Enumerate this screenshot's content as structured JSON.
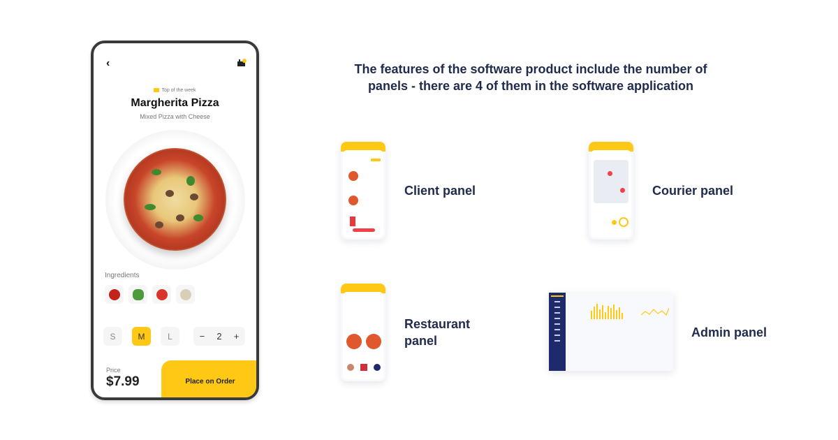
{
  "phone": {
    "back_icon": "chevron-left",
    "cart_icon": "basket",
    "badge": "Top of the week",
    "product_title": "Margherita Pizza",
    "product_subtitle": "Mixed Pizza with Cheese",
    "ingredients_label": "Ingredients",
    "ingredients": [
      "tomato-sauce",
      "vegetables",
      "tomatoes",
      "dough"
    ],
    "sizes": [
      {
        "label": "S",
        "selected": false
      },
      {
        "label": "M",
        "selected": true
      },
      {
        "label": "L",
        "selected": false
      }
    ],
    "quantity": {
      "minus": "−",
      "value": "2",
      "plus": "+"
    },
    "price_label": "Price",
    "price": "$7.99",
    "order_button": "Place on Order",
    "accent": "#ffc814"
  },
  "headline": "The features of the software product include the number of panels - there are 4 of them in the software application",
  "panels": [
    {
      "label": "Client panel"
    },
    {
      "label": "Courier panel"
    },
    {
      "label": "Restaurant panel"
    },
    {
      "label": "Admin panel"
    }
  ],
  "colors": {
    "text": "#1f2a4d",
    "accent": "#ffc814",
    "admin_sidebar": "#1e2a6b",
    "red": "#f0404a"
  }
}
